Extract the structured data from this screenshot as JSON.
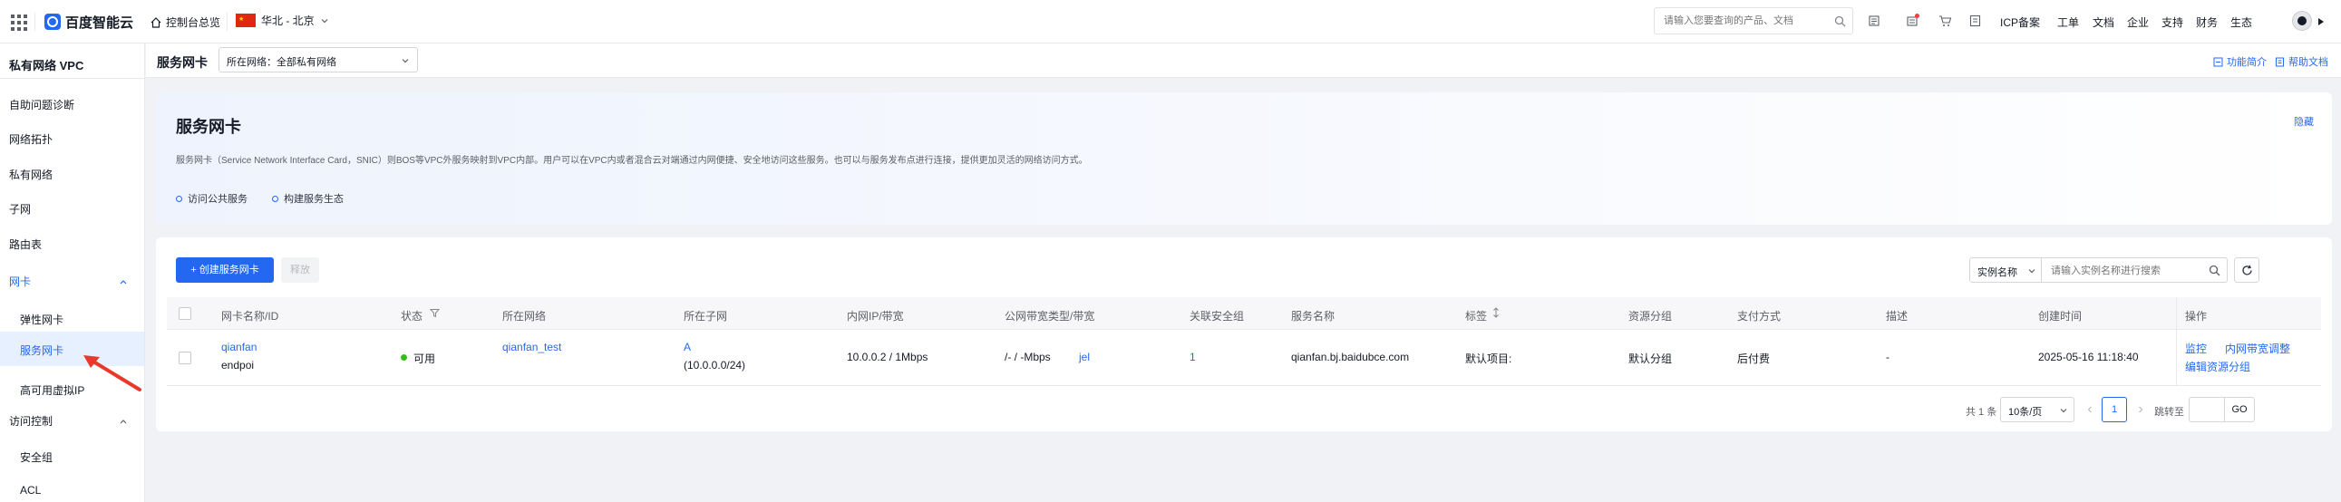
{
  "topbar": {
    "logo_text": "百度智能云",
    "console_home": "控制台总览",
    "region": "华北 - 北京",
    "search_placeholder": "请输入您要查询的产品、文档",
    "nav": [
      "ICP备案",
      "工单",
      "文档",
      "企业",
      "支持",
      "财务",
      "生态"
    ]
  },
  "sidebar": {
    "title": "私有网络 VPC",
    "items": [
      "自助问题诊断",
      "网络拓扑",
      "私有网络",
      "子网",
      "路由表"
    ],
    "group_nic": "网卡",
    "nic_items": [
      "弹性网卡",
      "服务网卡",
      "高可用虚拟IP"
    ],
    "group_acl": "访问控制",
    "acl_items": [
      "安全组",
      "ACL"
    ]
  },
  "page": {
    "title": "服务网卡",
    "network_filter": "所在网络：全部私有网络",
    "feature_intro": "功能简介",
    "help_doc": "帮助文档"
  },
  "intro": {
    "title": "服务网卡",
    "hide": "隐藏",
    "description": "服务网卡（Service Network Interface Card，SNIC）则BOS等VPC外服务映射到VPC内部。用户可以在VPC内或者混合云对端通过内网便捷、安全地访问这些服务。也可以与服务发布点进行连接，提供更加灵活的网络访问方式。",
    "links": [
      "访问公共服务",
      "构建服务生态"
    ]
  },
  "toolbar": {
    "create_button": "+ 创建服务网卡",
    "release_button": "释放",
    "search_field": "实例名称",
    "search_placeholder": "请输入实例名称进行搜索"
  },
  "table": {
    "headers": [
      "网卡名称/ID",
      "状态",
      "所在网络",
      "所在子网",
      "内网IP/带宽",
      "公网带宽类型/带宽",
      "关联安全组",
      "服务名称",
      "标签",
      "资源分组",
      "支付方式",
      "描述",
      "创建时间",
      "操作"
    ],
    "row": {
      "name": "qianfan",
      "id": "endpoi",
      "status": "可用",
      "network": "qianfan_test",
      "subnet": "A",
      "subnet_cidr": "(10.0.0.0/24)",
      "ip_bw": "10.0.0.2 / 1Mbps",
      "public_bw": "/- / -Mbps",
      "public_extra": "jel",
      "security_group": "1",
      "service_name": "qianfan.bj.baidubce.com",
      "tag": "默认项目:",
      "resource_group": "默认分组",
      "payment": "后付费",
      "description": "-",
      "created": "2025-05-16 11:18:40",
      "actions": [
        "监控",
        "内网带宽调整",
        "编辑资源分组"
      ]
    }
  },
  "pagination": {
    "total": "共 1 条",
    "page_size": "10条/页",
    "current_page": "1",
    "goto_label": "跳转至",
    "go_button": "GO"
  },
  "colors": {
    "accent": "#2468f2",
    "status_ok": "#30bf13",
    "arrow": "#e8392b"
  }
}
